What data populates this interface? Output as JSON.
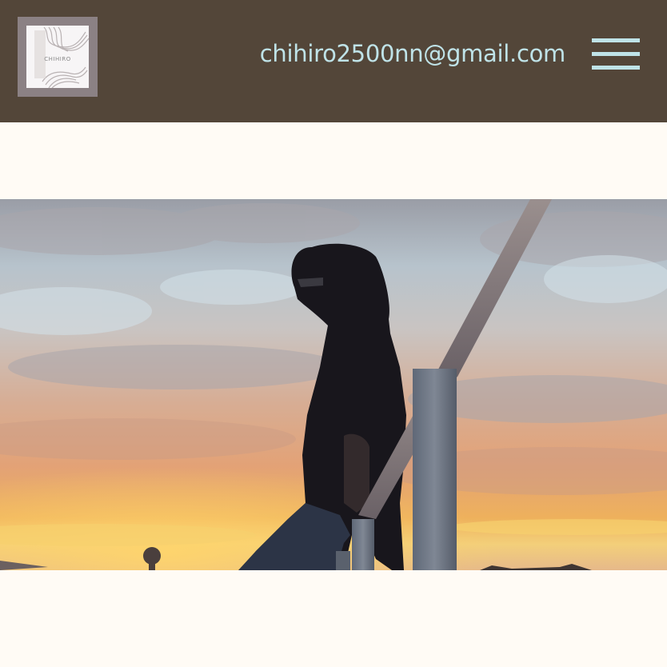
{
  "header": {
    "logo": {
      "text": "CHIHIRO",
      "icon": "swirl-logo-icon"
    },
    "email": "chihiro2500nn@gmail.com",
    "menu_icon": "hamburger-menu-icon"
  },
  "hero": {
    "image": "sunset-portrait-photo"
  },
  "colors": {
    "header_bg": "#534639",
    "accent": "#bfe3e8",
    "page_bg": "#fffbf5"
  }
}
